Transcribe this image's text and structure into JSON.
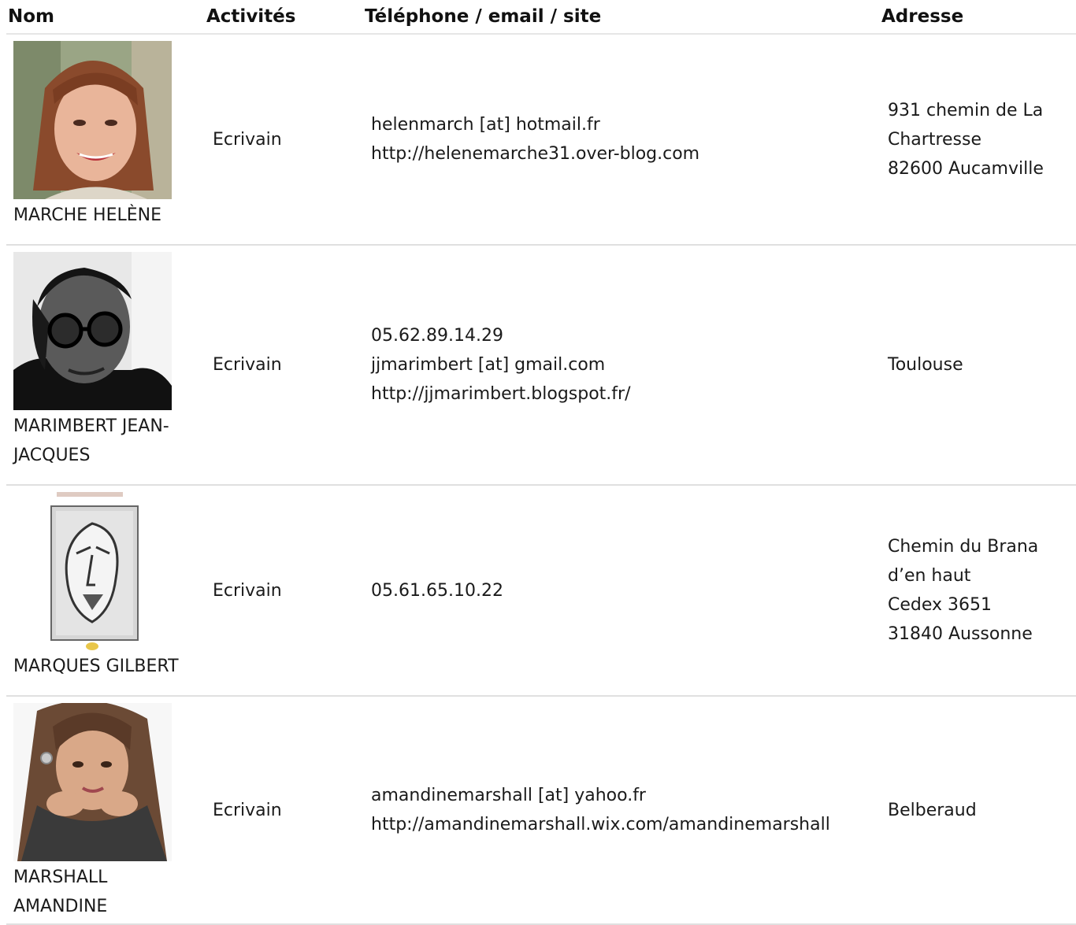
{
  "headers": {
    "nom": "Nom",
    "activites": "Activités",
    "contact": "Téléphone / email / site",
    "adresse": "Adresse"
  },
  "rows": [
    {
      "name": "MARCHE HELÈNE",
      "photo": "portrait-woman-smiling",
      "activity": "Ecrivain",
      "contact": [
        "helenmarch [at] hotmail.fr",
        "http://helenemarche31.over-blog.com"
      ],
      "address": [
        "931 chemin de La",
        "Chartresse",
        "82600 Aucamville"
      ]
    },
    {
      "name": "MARIMBERT JEAN-JACQUES",
      "photo": "portrait-man-black-white-glasses",
      "activity": "Ecrivain",
      "contact": [
        "05.62.89.14.29",
        "jjmarimbert [at] gmail.com",
        "http://jjmarimbert.blogspot.fr/"
      ],
      "address": [
        "Toulouse"
      ]
    },
    {
      "name": "MARQUES GILBERT",
      "photo": "book-cover-face-sketch",
      "activity": "Ecrivain",
      "contact": [
        "05.61.65.10.22"
      ],
      "address": [
        "Chemin du Brana",
        "d’en haut",
        "Cedex 3651",
        "31840 Aussonne"
      ]
    },
    {
      "name": "MARSHALL AMANDINE",
      "photo": "portrait-woman-hands-on-face",
      "activity": "Ecrivain",
      "contact": [
        "amandinemarshall [at] yahoo.fr",
        "http://amandinemarshall.wix.com/amandinemarshall"
      ],
      "address": [
        "Belberaud"
      ]
    }
  ]
}
